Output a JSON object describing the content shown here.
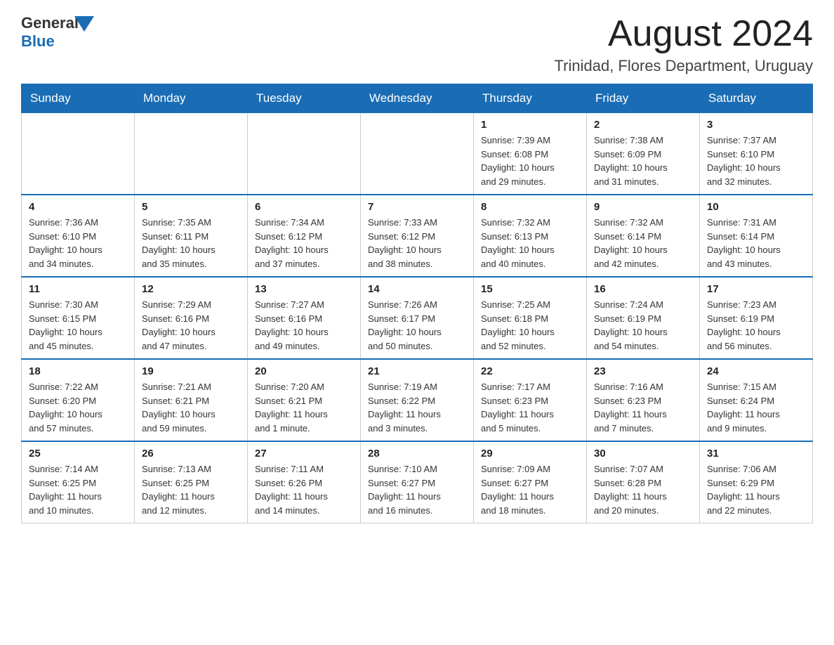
{
  "header": {
    "logo_text_general": "General",
    "logo_text_blue": "Blue",
    "month_year": "August 2024",
    "location": "Trinidad, Flores Department, Uruguay"
  },
  "weekdays": [
    "Sunday",
    "Monday",
    "Tuesday",
    "Wednesday",
    "Thursday",
    "Friday",
    "Saturday"
  ],
  "weeks": [
    [
      {
        "day": "",
        "info": ""
      },
      {
        "day": "",
        "info": ""
      },
      {
        "day": "",
        "info": ""
      },
      {
        "day": "",
        "info": ""
      },
      {
        "day": "1",
        "info": "Sunrise: 7:39 AM\nSunset: 6:08 PM\nDaylight: 10 hours\nand 29 minutes."
      },
      {
        "day": "2",
        "info": "Sunrise: 7:38 AM\nSunset: 6:09 PM\nDaylight: 10 hours\nand 31 minutes."
      },
      {
        "day": "3",
        "info": "Sunrise: 7:37 AM\nSunset: 6:10 PM\nDaylight: 10 hours\nand 32 minutes."
      }
    ],
    [
      {
        "day": "4",
        "info": "Sunrise: 7:36 AM\nSunset: 6:10 PM\nDaylight: 10 hours\nand 34 minutes."
      },
      {
        "day": "5",
        "info": "Sunrise: 7:35 AM\nSunset: 6:11 PM\nDaylight: 10 hours\nand 35 minutes."
      },
      {
        "day": "6",
        "info": "Sunrise: 7:34 AM\nSunset: 6:12 PM\nDaylight: 10 hours\nand 37 minutes."
      },
      {
        "day": "7",
        "info": "Sunrise: 7:33 AM\nSunset: 6:12 PM\nDaylight: 10 hours\nand 38 minutes."
      },
      {
        "day": "8",
        "info": "Sunrise: 7:32 AM\nSunset: 6:13 PM\nDaylight: 10 hours\nand 40 minutes."
      },
      {
        "day": "9",
        "info": "Sunrise: 7:32 AM\nSunset: 6:14 PM\nDaylight: 10 hours\nand 42 minutes."
      },
      {
        "day": "10",
        "info": "Sunrise: 7:31 AM\nSunset: 6:14 PM\nDaylight: 10 hours\nand 43 minutes."
      }
    ],
    [
      {
        "day": "11",
        "info": "Sunrise: 7:30 AM\nSunset: 6:15 PM\nDaylight: 10 hours\nand 45 minutes."
      },
      {
        "day": "12",
        "info": "Sunrise: 7:29 AM\nSunset: 6:16 PM\nDaylight: 10 hours\nand 47 minutes."
      },
      {
        "day": "13",
        "info": "Sunrise: 7:27 AM\nSunset: 6:16 PM\nDaylight: 10 hours\nand 49 minutes."
      },
      {
        "day": "14",
        "info": "Sunrise: 7:26 AM\nSunset: 6:17 PM\nDaylight: 10 hours\nand 50 minutes."
      },
      {
        "day": "15",
        "info": "Sunrise: 7:25 AM\nSunset: 6:18 PM\nDaylight: 10 hours\nand 52 minutes."
      },
      {
        "day": "16",
        "info": "Sunrise: 7:24 AM\nSunset: 6:19 PM\nDaylight: 10 hours\nand 54 minutes."
      },
      {
        "day": "17",
        "info": "Sunrise: 7:23 AM\nSunset: 6:19 PM\nDaylight: 10 hours\nand 56 minutes."
      }
    ],
    [
      {
        "day": "18",
        "info": "Sunrise: 7:22 AM\nSunset: 6:20 PM\nDaylight: 10 hours\nand 57 minutes."
      },
      {
        "day": "19",
        "info": "Sunrise: 7:21 AM\nSunset: 6:21 PM\nDaylight: 10 hours\nand 59 minutes."
      },
      {
        "day": "20",
        "info": "Sunrise: 7:20 AM\nSunset: 6:21 PM\nDaylight: 11 hours\nand 1 minute."
      },
      {
        "day": "21",
        "info": "Sunrise: 7:19 AM\nSunset: 6:22 PM\nDaylight: 11 hours\nand 3 minutes."
      },
      {
        "day": "22",
        "info": "Sunrise: 7:17 AM\nSunset: 6:23 PM\nDaylight: 11 hours\nand 5 minutes."
      },
      {
        "day": "23",
        "info": "Sunrise: 7:16 AM\nSunset: 6:23 PM\nDaylight: 11 hours\nand 7 minutes."
      },
      {
        "day": "24",
        "info": "Sunrise: 7:15 AM\nSunset: 6:24 PM\nDaylight: 11 hours\nand 9 minutes."
      }
    ],
    [
      {
        "day": "25",
        "info": "Sunrise: 7:14 AM\nSunset: 6:25 PM\nDaylight: 11 hours\nand 10 minutes."
      },
      {
        "day": "26",
        "info": "Sunrise: 7:13 AM\nSunset: 6:25 PM\nDaylight: 11 hours\nand 12 minutes."
      },
      {
        "day": "27",
        "info": "Sunrise: 7:11 AM\nSunset: 6:26 PM\nDaylight: 11 hours\nand 14 minutes."
      },
      {
        "day": "28",
        "info": "Sunrise: 7:10 AM\nSunset: 6:27 PM\nDaylight: 11 hours\nand 16 minutes."
      },
      {
        "day": "29",
        "info": "Sunrise: 7:09 AM\nSunset: 6:27 PM\nDaylight: 11 hours\nand 18 minutes."
      },
      {
        "day": "30",
        "info": "Sunrise: 7:07 AM\nSunset: 6:28 PM\nDaylight: 11 hours\nand 20 minutes."
      },
      {
        "day": "31",
        "info": "Sunrise: 7:06 AM\nSunset: 6:29 PM\nDaylight: 11 hours\nand 22 minutes."
      }
    ]
  ]
}
